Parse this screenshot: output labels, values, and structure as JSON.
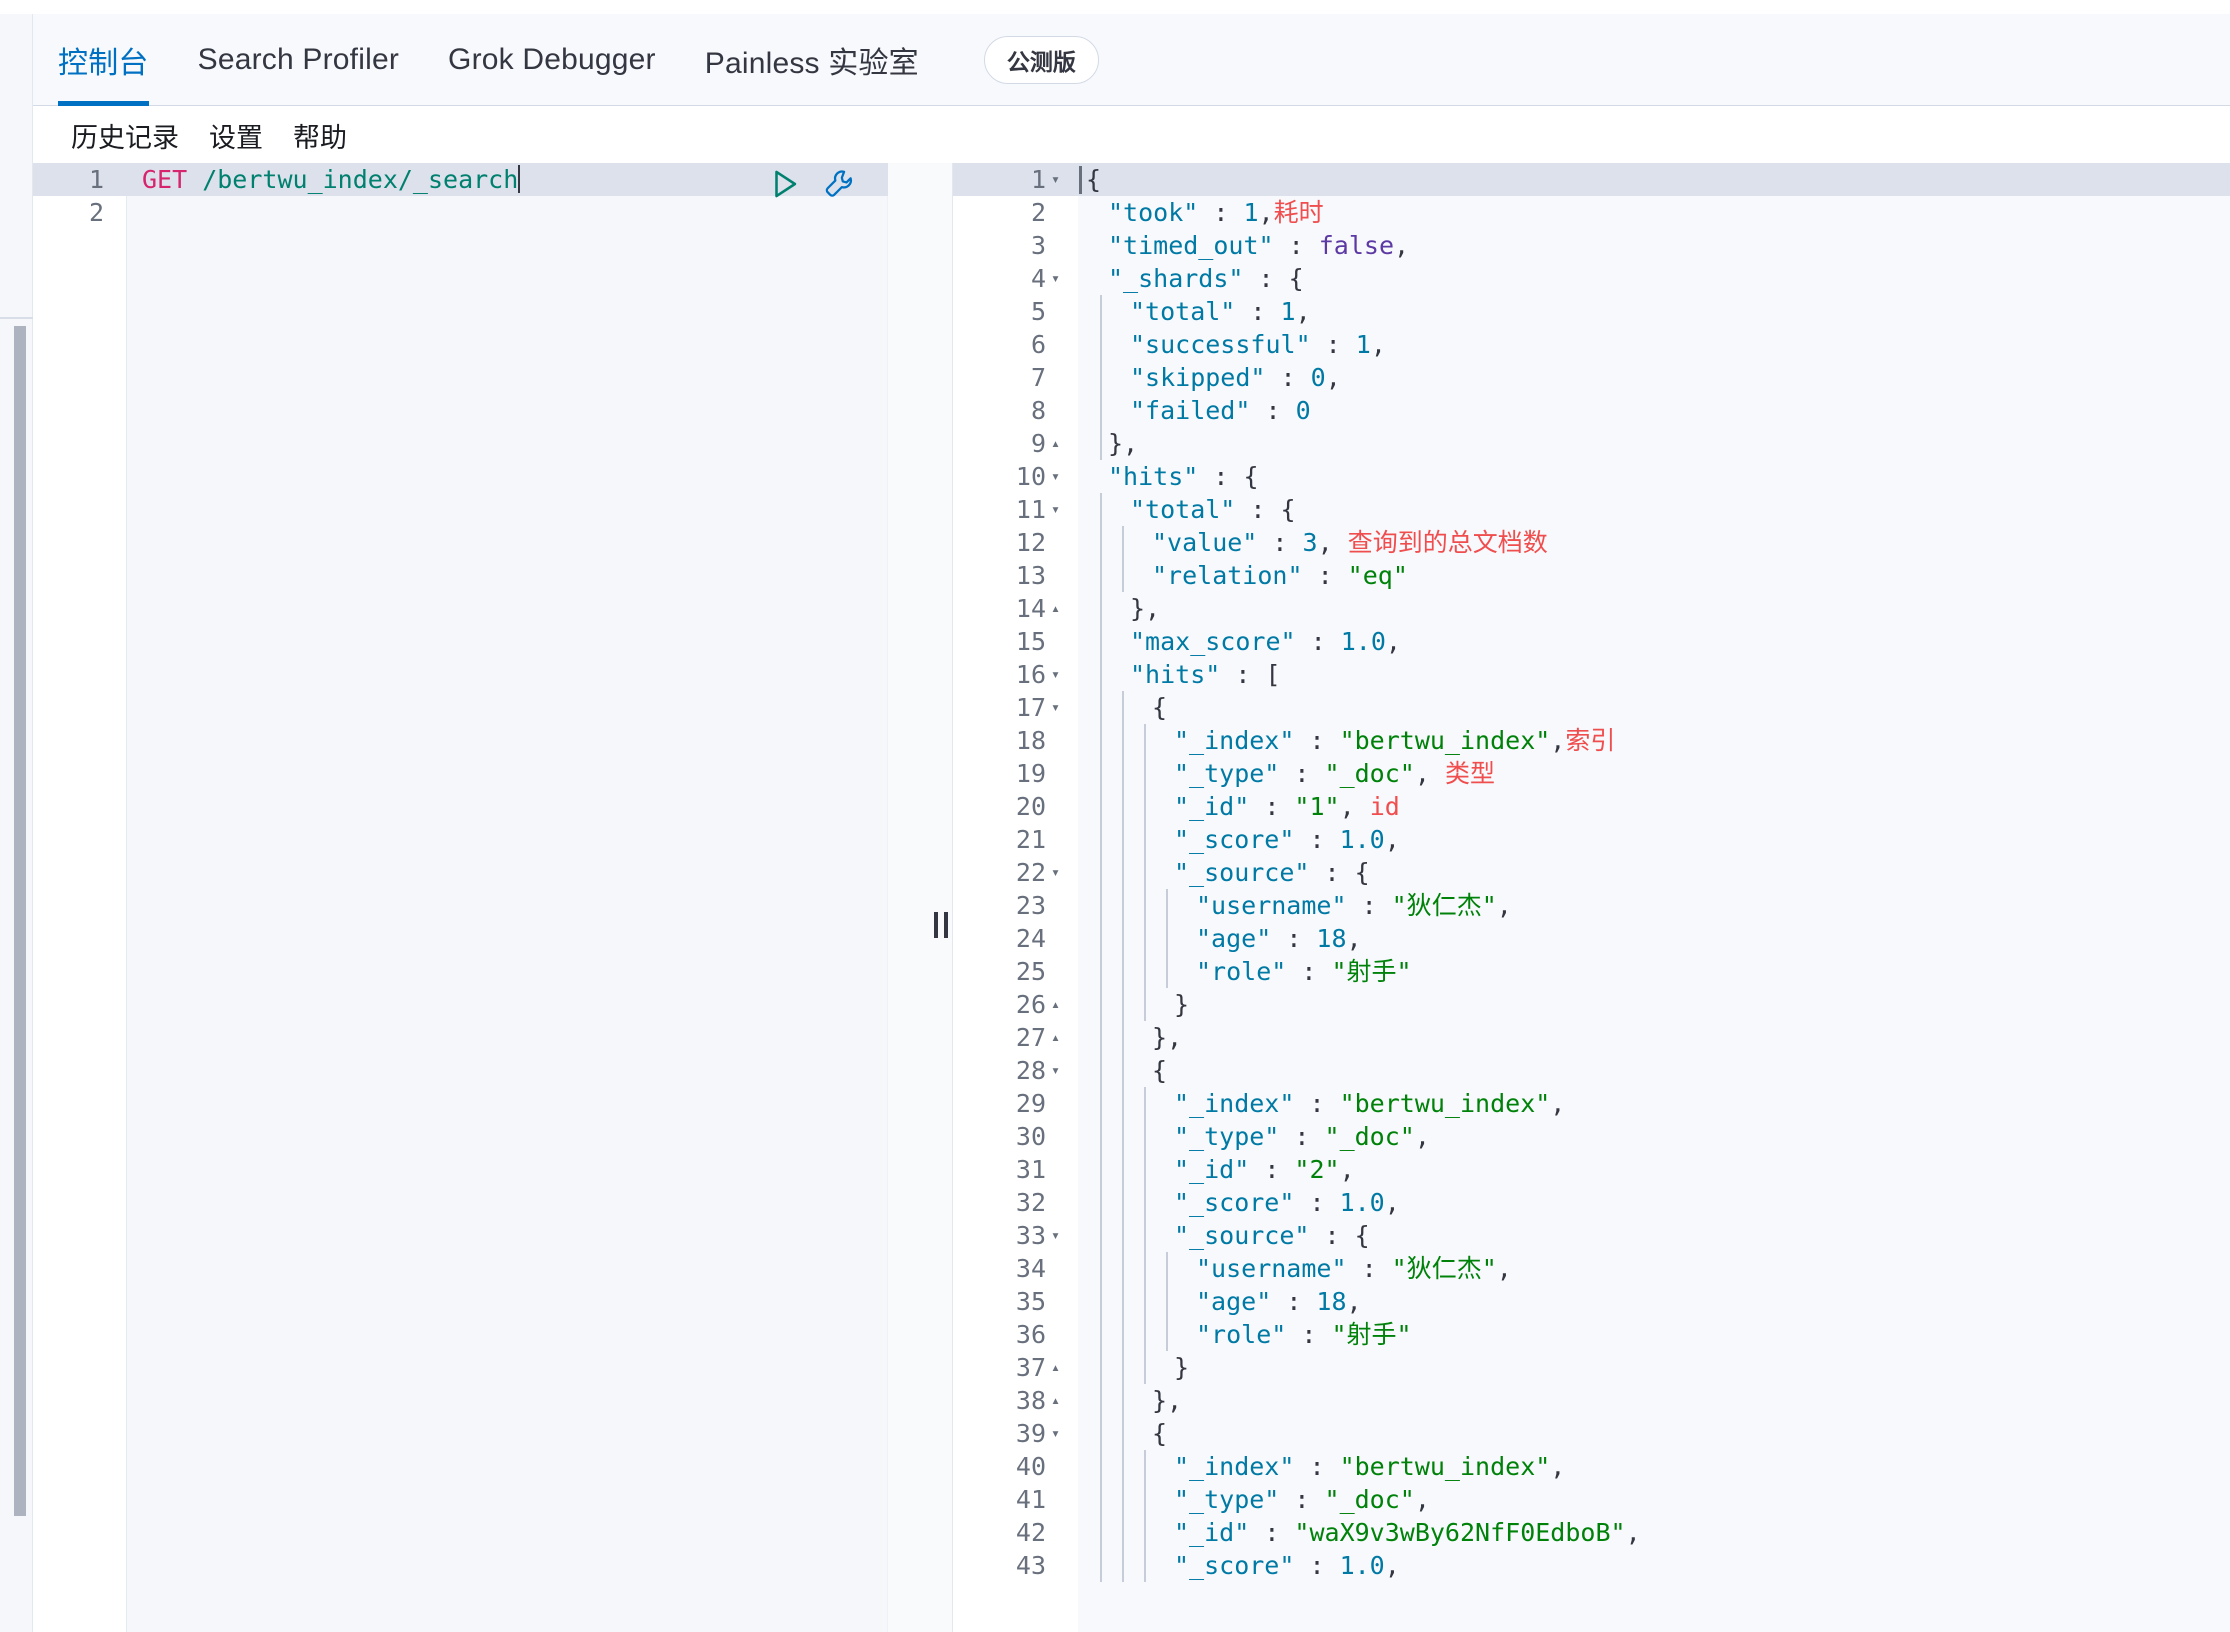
{
  "tabs": [
    {
      "label": "控制台",
      "active": true
    },
    {
      "label": "Search Profiler",
      "active": false
    },
    {
      "label": "Grok Debugger",
      "active": false
    },
    {
      "label": "Painless 实验室",
      "active": false
    }
  ],
  "beta_badge": "公测版",
  "submenu": [
    {
      "label": "历史记录"
    },
    {
      "label": "设置"
    },
    {
      "label": "帮助"
    }
  ],
  "request_editor": {
    "lines": [
      {
        "no": "1",
        "verb": "GET",
        "url": " /bertwu_index/_search",
        "highlighted": true,
        "caret": true
      },
      {
        "no": "2",
        "verb": "",
        "url": "",
        "highlighted": false,
        "caret": false
      }
    ],
    "actions": {
      "play": "play-icon",
      "wrench": "wrench-icon"
    }
  },
  "response_editor": {
    "lines": [
      {
        "no": "1",
        "fold": "▾",
        "indent": 0,
        "hl": true,
        "tokens": [
          {
            "t": "{",
            "c": "p"
          }
        ]
      },
      {
        "no": "2",
        "fold": "",
        "indent": 1,
        "hl": false,
        "tokens": [
          {
            "t": "\"took\"",
            "c": "k"
          },
          {
            "t": " : ",
            "c": "p"
          },
          {
            "t": "1",
            "c": "n"
          },
          {
            "t": ",",
            "c": "p"
          },
          {
            "t": "耗时",
            "c": "ann"
          }
        ]
      },
      {
        "no": "3",
        "fold": "",
        "indent": 1,
        "hl": false,
        "tokens": [
          {
            "t": "\"timed_out\"",
            "c": "k"
          },
          {
            "t": " : ",
            "c": "p"
          },
          {
            "t": "false",
            "c": "b"
          },
          {
            "t": ",",
            "c": "p"
          }
        ]
      },
      {
        "no": "4",
        "fold": "▾",
        "indent": 1,
        "hl": false,
        "tokens": [
          {
            "t": "\"_shards\"",
            "c": "k"
          },
          {
            "t": " : {",
            "c": "p"
          }
        ]
      },
      {
        "no": "5",
        "fold": "",
        "indent": 2,
        "hl": false,
        "tokens": [
          {
            "t": "\"total\"",
            "c": "k"
          },
          {
            "t": " : ",
            "c": "p"
          },
          {
            "t": "1",
            "c": "n"
          },
          {
            "t": ",",
            "c": "p"
          }
        ]
      },
      {
        "no": "6",
        "fold": "",
        "indent": 2,
        "hl": false,
        "tokens": [
          {
            "t": "\"successful\"",
            "c": "k"
          },
          {
            "t": " : ",
            "c": "p"
          },
          {
            "t": "1",
            "c": "n"
          },
          {
            "t": ",",
            "c": "p"
          }
        ]
      },
      {
        "no": "7",
        "fold": "",
        "indent": 2,
        "hl": false,
        "tokens": [
          {
            "t": "\"skipped\"",
            "c": "k"
          },
          {
            "t": " : ",
            "c": "p"
          },
          {
            "t": "0",
            "c": "n"
          },
          {
            "t": ",",
            "c": "p"
          }
        ]
      },
      {
        "no": "8",
        "fold": "",
        "indent": 2,
        "hl": false,
        "tokens": [
          {
            "t": "\"failed\"",
            "c": "k"
          },
          {
            "t": " : ",
            "c": "p"
          },
          {
            "t": "0",
            "c": "n"
          }
        ]
      },
      {
        "no": "9",
        "fold": "▴",
        "indent": 1,
        "hl": false,
        "tokens": [
          {
            "t": "},",
            "c": "p"
          }
        ]
      },
      {
        "no": "10",
        "fold": "▾",
        "indent": 1,
        "hl": false,
        "tokens": [
          {
            "t": "\"hits\"",
            "c": "k"
          },
          {
            "t": " : {",
            "c": "p"
          }
        ]
      },
      {
        "no": "11",
        "fold": "▾",
        "indent": 2,
        "hl": false,
        "tokens": [
          {
            "t": "\"total\"",
            "c": "k"
          },
          {
            "t": " : {",
            "c": "p"
          }
        ]
      },
      {
        "no": "12",
        "fold": "",
        "indent": 3,
        "hl": false,
        "tokens": [
          {
            "t": "\"value\"",
            "c": "k"
          },
          {
            "t": " : ",
            "c": "p"
          },
          {
            "t": "3",
            "c": "n"
          },
          {
            "t": ", ",
            "c": "p"
          },
          {
            "t": "查询到的总文档数",
            "c": "ann"
          }
        ]
      },
      {
        "no": "13",
        "fold": "",
        "indent": 3,
        "hl": false,
        "tokens": [
          {
            "t": "\"relation\"",
            "c": "k"
          },
          {
            "t": " : ",
            "c": "p"
          },
          {
            "t": "\"eq\"",
            "c": "s"
          }
        ]
      },
      {
        "no": "14",
        "fold": "▴",
        "indent": 2,
        "hl": false,
        "tokens": [
          {
            "t": "},",
            "c": "p"
          }
        ]
      },
      {
        "no": "15",
        "fold": "",
        "indent": 2,
        "hl": false,
        "tokens": [
          {
            "t": "\"max_score\"",
            "c": "k"
          },
          {
            "t": " : ",
            "c": "p"
          },
          {
            "t": "1.0",
            "c": "n"
          },
          {
            "t": ",",
            "c": "p"
          }
        ]
      },
      {
        "no": "16",
        "fold": "▾",
        "indent": 2,
        "hl": false,
        "tokens": [
          {
            "t": "\"hits\"",
            "c": "k"
          },
          {
            "t": " : [",
            "c": "p"
          }
        ]
      },
      {
        "no": "17",
        "fold": "▾",
        "indent": 3,
        "hl": false,
        "tokens": [
          {
            "t": "{",
            "c": "p"
          }
        ]
      },
      {
        "no": "18",
        "fold": "",
        "indent": 4,
        "hl": false,
        "tokens": [
          {
            "t": "\"_index\"",
            "c": "k"
          },
          {
            "t": " : ",
            "c": "p"
          },
          {
            "t": "\"bertwu_index\"",
            "c": "s"
          },
          {
            "t": ",",
            "c": "p"
          },
          {
            "t": "索引",
            "c": "ann"
          }
        ]
      },
      {
        "no": "19",
        "fold": "",
        "indent": 4,
        "hl": false,
        "tokens": [
          {
            "t": "\"_type\"",
            "c": "k"
          },
          {
            "t": " : ",
            "c": "p"
          },
          {
            "t": "\"_doc\"",
            "c": "s"
          },
          {
            "t": ", ",
            "c": "p"
          },
          {
            "t": "类型",
            "c": "ann"
          }
        ]
      },
      {
        "no": "20",
        "fold": "",
        "indent": 4,
        "hl": false,
        "tokens": [
          {
            "t": "\"_id\"",
            "c": "k"
          },
          {
            "t": " : ",
            "c": "p"
          },
          {
            "t": "\"1\"",
            "c": "s"
          },
          {
            "t": ", ",
            "c": "p"
          },
          {
            "t": "id",
            "c": "ann"
          }
        ]
      },
      {
        "no": "21",
        "fold": "",
        "indent": 4,
        "hl": false,
        "tokens": [
          {
            "t": "\"_score\"",
            "c": "k"
          },
          {
            "t": " : ",
            "c": "p"
          },
          {
            "t": "1.0",
            "c": "n"
          },
          {
            "t": ",",
            "c": "p"
          }
        ]
      },
      {
        "no": "22",
        "fold": "▾",
        "indent": 4,
        "hl": false,
        "tokens": [
          {
            "t": "\"_source\"",
            "c": "k"
          },
          {
            "t": " : {",
            "c": "p"
          }
        ]
      },
      {
        "no": "23",
        "fold": "",
        "indent": 5,
        "hl": false,
        "tokens": [
          {
            "t": "\"username\"",
            "c": "k"
          },
          {
            "t": " : ",
            "c": "p"
          },
          {
            "t": "\"狄仁杰\"",
            "c": "s"
          },
          {
            "t": ",",
            "c": "p"
          }
        ]
      },
      {
        "no": "24",
        "fold": "",
        "indent": 5,
        "hl": false,
        "tokens": [
          {
            "t": "\"age\"",
            "c": "k"
          },
          {
            "t": " : ",
            "c": "p"
          },
          {
            "t": "18",
            "c": "n"
          },
          {
            "t": ",",
            "c": "p"
          }
        ]
      },
      {
        "no": "25",
        "fold": "",
        "indent": 5,
        "hl": false,
        "tokens": [
          {
            "t": "\"role\"",
            "c": "k"
          },
          {
            "t": " : ",
            "c": "p"
          },
          {
            "t": "\"射手\"",
            "c": "s"
          }
        ]
      },
      {
        "no": "26",
        "fold": "▴",
        "indent": 4,
        "hl": false,
        "tokens": [
          {
            "t": "}",
            "c": "p"
          }
        ]
      },
      {
        "no": "27",
        "fold": "▴",
        "indent": 3,
        "hl": false,
        "tokens": [
          {
            "t": "},",
            "c": "p"
          }
        ]
      },
      {
        "no": "28",
        "fold": "▾",
        "indent": 3,
        "hl": false,
        "tokens": [
          {
            "t": "{",
            "c": "p"
          }
        ]
      },
      {
        "no": "29",
        "fold": "",
        "indent": 4,
        "hl": false,
        "tokens": [
          {
            "t": "\"_index\"",
            "c": "k"
          },
          {
            "t": " : ",
            "c": "p"
          },
          {
            "t": "\"bertwu_index\"",
            "c": "s"
          },
          {
            "t": ",",
            "c": "p"
          }
        ]
      },
      {
        "no": "30",
        "fold": "",
        "indent": 4,
        "hl": false,
        "tokens": [
          {
            "t": "\"_type\"",
            "c": "k"
          },
          {
            "t": " : ",
            "c": "p"
          },
          {
            "t": "\"_doc\"",
            "c": "s"
          },
          {
            "t": ",",
            "c": "p"
          }
        ]
      },
      {
        "no": "31",
        "fold": "",
        "indent": 4,
        "hl": false,
        "tokens": [
          {
            "t": "\"_id\"",
            "c": "k"
          },
          {
            "t": " : ",
            "c": "p"
          },
          {
            "t": "\"2\"",
            "c": "s"
          },
          {
            "t": ",",
            "c": "p"
          }
        ]
      },
      {
        "no": "32",
        "fold": "",
        "indent": 4,
        "hl": false,
        "tokens": [
          {
            "t": "\"_score\"",
            "c": "k"
          },
          {
            "t": " : ",
            "c": "p"
          },
          {
            "t": "1.0",
            "c": "n"
          },
          {
            "t": ",",
            "c": "p"
          }
        ]
      },
      {
        "no": "33",
        "fold": "▾",
        "indent": 4,
        "hl": false,
        "tokens": [
          {
            "t": "\"_source\"",
            "c": "k"
          },
          {
            "t": " : {",
            "c": "p"
          }
        ]
      },
      {
        "no": "34",
        "fold": "",
        "indent": 5,
        "hl": false,
        "tokens": [
          {
            "t": "\"username\"",
            "c": "k"
          },
          {
            "t": " : ",
            "c": "p"
          },
          {
            "t": "\"狄仁杰\"",
            "c": "s"
          },
          {
            "t": ",",
            "c": "p"
          }
        ]
      },
      {
        "no": "35",
        "fold": "",
        "indent": 5,
        "hl": false,
        "tokens": [
          {
            "t": "\"age\"",
            "c": "k"
          },
          {
            "t": " : ",
            "c": "p"
          },
          {
            "t": "18",
            "c": "n"
          },
          {
            "t": ",",
            "c": "p"
          }
        ]
      },
      {
        "no": "36",
        "fold": "",
        "indent": 5,
        "hl": false,
        "tokens": [
          {
            "t": "\"role\"",
            "c": "k"
          },
          {
            "t": " : ",
            "c": "p"
          },
          {
            "t": "\"射手\"",
            "c": "s"
          }
        ]
      },
      {
        "no": "37",
        "fold": "▴",
        "indent": 4,
        "hl": false,
        "tokens": [
          {
            "t": "}",
            "c": "p"
          }
        ]
      },
      {
        "no": "38",
        "fold": "▴",
        "indent": 3,
        "hl": false,
        "tokens": [
          {
            "t": "},",
            "c": "p"
          }
        ]
      },
      {
        "no": "39",
        "fold": "▾",
        "indent": 3,
        "hl": false,
        "tokens": [
          {
            "t": "{",
            "c": "p"
          }
        ]
      },
      {
        "no": "40",
        "fold": "",
        "indent": 4,
        "hl": false,
        "tokens": [
          {
            "t": "\"_index\"",
            "c": "k"
          },
          {
            "t": " : ",
            "c": "p"
          },
          {
            "t": "\"bertwu_index\"",
            "c": "s"
          },
          {
            "t": ",",
            "c": "p"
          }
        ]
      },
      {
        "no": "41",
        "fold": "",
        "indent": 4,
        "hl": false,
        "tokens": [
          {
            "t": "\"_type\"",
            "c": "k"
          },
          {
            "t": " : ",
            "c": "p"
          },
          {
            "t": "\"_doc\"",
            "c": "s"
          },
          {
            "t": ",",
            "c": "p"
          }
        ]
      },
      {
        "no": "42",
        "fold": "",
        "indent": 4,
        "hl": false,
        "tokens": [
          {
            "t": "\"_id\"",
            "c": "k"
          },
          {
            "t": " : ",
            "c": "p"
          },
          {
            "t": "\"waX9v3wBy62NfF0EdboB\"",
            "c": "s"
          },
          {
            "t": ",",
            "c": "p"
          }
        ]
      },
      {
        "no": "43",
        "fold": "",
        "indent": 4,
        "hl": false,
        "tokens": [
          {
            "t": "\"_score\"",
            "c": "k"
          },
          {
            "t": " : ",
            "c": "p"
          },
          {
            "t": "1.0",
            "c": "n"
          },
          {
            "t": ",",
            "c": "p"
          }
        ]
      }
    ]
  },
  "colors": {
    "accent": "#0071c2",
    "key": "#0079a5",
    "string": "#00820a",
    "boolean": "#5c39a3",
    "annotation": "#f04e4e",
    "verb": "#d6246e",
    "url": "#00806e",
    "highlight_row": "#dce1ec"
  }
}
